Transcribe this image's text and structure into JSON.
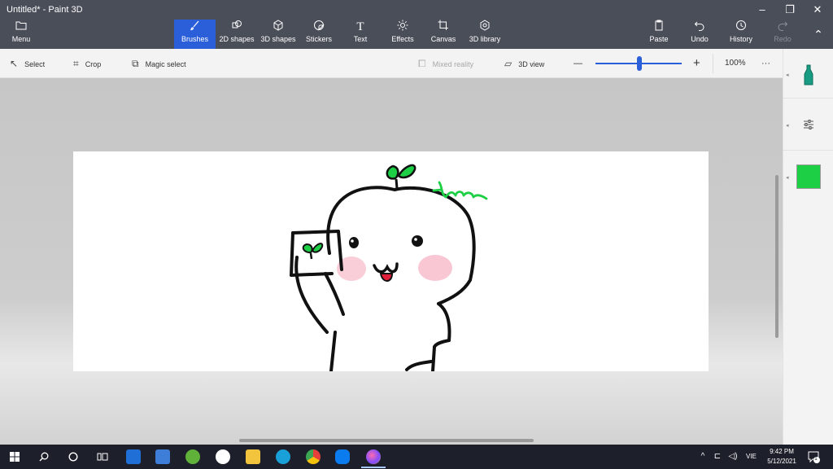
{
  "window": {
    "title": "Untitled* - Paint 3D"
  },
  "window_controls": {
    "minimize": "–",
    "maximize": "❐",
    "close": "✕"
  },
  "ribbon": {
    "menu": "Menu",
    "tools": [
      {
        "key": "brushes",
        "label": "Brushes",
        "active": true
      },
      {
        "key": "2d-shapes",
        "label": "2D shapes"
      },
      {
        "key": "3d-shapes",
        "label": "3D shapes"
      },
      {
        "key": "stickers",
        "label": "Stickers"
      },
      {
        "key": "text",
        "label": "Text"
      },
      {
        "key": "effects",
        "label": "Effects"
      },
      {
        "key": "canvas",
        "label": "Canvas"
      },
      {
        "key": "3d-library",
        "label": "3D library"
      }
    ],
    "paste": "Paste",
    "undo": "Undo",
    "history": "History",
    "redo": "Redo",
    "text_icon": "T",
    "collapse_icon": "⌃"
  },
  "toolbar": {
    "select": "Select",
    "crop": "Crop",
    "magic_select": "Magic select",
    "mixed_reality": "Mixed reality",
    "view_3d": "3D view",
    "zoom_minus": "—",
    "zoom_plus": "+",
    "zoom_level": "100%",
    "more": "···"
  },
  "taskbar": {
    "time": "9:42 PM",
    "date": "5/12/2021",
    "language": "VIE",
    "notification_count": "1",
    "tray_chevron": "^"
  },
  "colors": {
    "accent": "#2b5fd9",
    "current_color": "#1ccf45",
    "title_bar": "#4a4e59",
    "taskbar": "#1d1f2a"
  }
}
